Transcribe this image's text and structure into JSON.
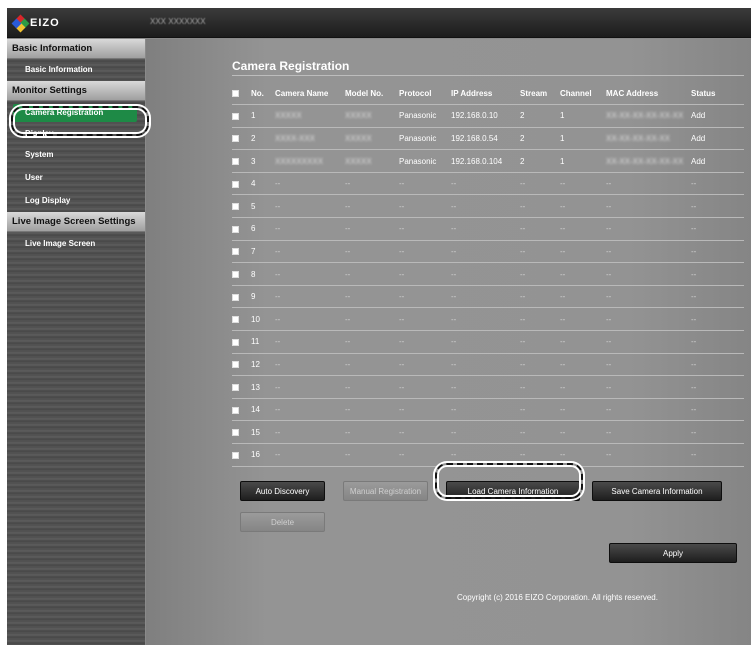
{
  "header": {
    "brand": "EIZO",
    "device_name": "XXX XXXXXXX"
  },
  "sidebar": {
    "sections": [
      {
        "title": "Basic Information",
        "items": [
          "Basic Information"
        ]
      },
      {
        "title": "Monitor Settings",
        "items": [
          "Camera Registration",
          "Display",
          "System",
          "User",
          "Log Display"
        ]
      },
      {
        "title": "Live Image Screen Settings",
        "items": [
          "Live Image Screen"
        ]
      }
    ],
    "active_item": "Camera Registration"
  },
  "main": {
    "title": "Camera Registration",
    "columns": [
      "No.",
      "Camera Name",
      "Model No.",
      "Protocol",
      "IP Address",
      "Stream",
      "Channel",
      "MAC Address",
      "Status"
    ],
    "rows": [
      {
        "no": "1",
        "camera_name": "XXXXX",
        "model": "XXXXX",
        "protocol": "Panasonic",
        "ip": "192.168.0.10",
        "stream": "2",
        "channel": "1",
        "mac": "XX-XX-XX-XX-XX-XX",
        "status": "Add"
      },
      {
        "no": "2",
        "camera_name": "XXXX-XXX",
        "model": "XXXXX",
        "protocol": "Panasonic",
        "ip": "192.168.0.54",
        "stream": "2",
        "channel": "1",
        "mac": "XX-XX-XX-XX-XX",
        "status": "Add"
      },
      {
        "no": "3",
        "camera_name": "XXXXXXXXX",
        "model": "XXXXX",
        "protocol": "Panasonic",
        "ip": "192.168.0.104",
        "stream": "2",
        "channel": "1",
        "mac": "XX-XX-XX-XX-XX-XX",
        "status": "Add"
      },
      {
        "no": "4",
        "camera_name": "--",
        "model": "--",
        "protocol": "--",
        "ip": "--",
        "stream": "--",
        "channel": "--",
        "mac": "--",
        "status": "--"
      },
      {
        "no": "5",
        "camera_name": "--",
        "model": "--",
        "protocol": "--",
        "ip": "--",
        "stream": "--",
        "channel": "--",
        "mac": "--",
        "status": "--"
      },
      {
        "no": "6",
        "camera_name": "--",
        "model": "--",
        "protocol": "--",
        "ip": "--",
        "stream": "--",
        "channel": "--",
        "mac": "--",
        "status": "--"
      },
      {
        "no": "7",
        "camera_name": "--",
        "model": "--",
        "protocol": "--",
        "ip": "--",
        "stream": "--",
        "channel": "--",
        "mac": "--",
        "status": "--"
      },
      {
        "no": "8",
        "camera_name": "--",
        "model": "--",
        "protocol": "--",
        "ip": "--",
        "stream": "--",
        "channel": "--",
        "mac": "--",
        "status": "--"
      },
      {
        "no": "9",
        "camera_name": "--",
        "model": "--",
        "protocol": "--",
        "ip": "--",
        "stream": "--",
        "channel": "--",
        "mac": "--",
        "status": "--"
      },
      {
        "no": "10",
        "camera_name": "--",
        "model": "--",
        "protocol": "--",
        "ip": "--",
        "stream": "--",
        "channel": "--",
        "mac": "--",
        "status": "--"
      },
      {
        "no": "11",
        "camera_name": "--",
        "model": "--",
        "protocol": "--",
        "ip": "--",
        "stream": "--",
        "channel": "--",
        "mac": "--",
        "status": "--"
      },
      {
        "no": "12",
        "camera_name": "--",
        "model": "--",
        "protocol": "--",
        "ip": "--",
        "stream": "--",
        "channel": "--",
        "mac": "--",
        "status": "--"
      },
      {
        "no": "13",
        "camera_name": "--",
        "model": "--",
        "protocol": "--",
        "ip": "--",
        "stream": "--",
        "channel": "--",
        "mac": "--",
        "status": "--"
      },
      {
        "no": "14",
        "camera_name": "--",
        "model": "--",
        "protocol": "--",
        "ip": "--",
        "stream": "--",
        "channel": "--",
        "mac": "--",
        "status": "--"
      },
      {
        "no": "15",
        "camera_name": "--",
        "model": "--",
        "protocol": "--",
        "ip": "--",
        "stream": "--",
        "channel": "--",
        "mac": "--",
        "status": "--"
      },
      {
        "no": "16",
        "camera_name": "--",
        "model": "--",
        "protocol": "--",
        "ip": "--",
        "stream": "--",
        "channel": "--",
        "mac": "--",
        "status": "--"
      }
    ],
    "buttons": {
      "auto_discovery": "Auto Discovery",
      "manual_registration": "Manual Registration",
      "load_camera_info": "Load Camera Information",
      "save_camera_info": "Save Camera Information",
      "delete": "Delete",
      "apply": "Apply"
    },
    "copyright": "Copyright (c) 2016 EIZO Corporation. All rights reserved."
  },
  "colors": {
    "accent_green": "#1e8a46",
    "logo_red": "#d9262a",
    "logo_blue": "#2a5bd7",
    "logo_yellow": "#f2c230",
    "logo_green": "#2c9a45"
  },
  "icons": {
    "logo": "eizo-diamond-logo-icon",
    "checkbox": "checkbox-icon"
  }
}
